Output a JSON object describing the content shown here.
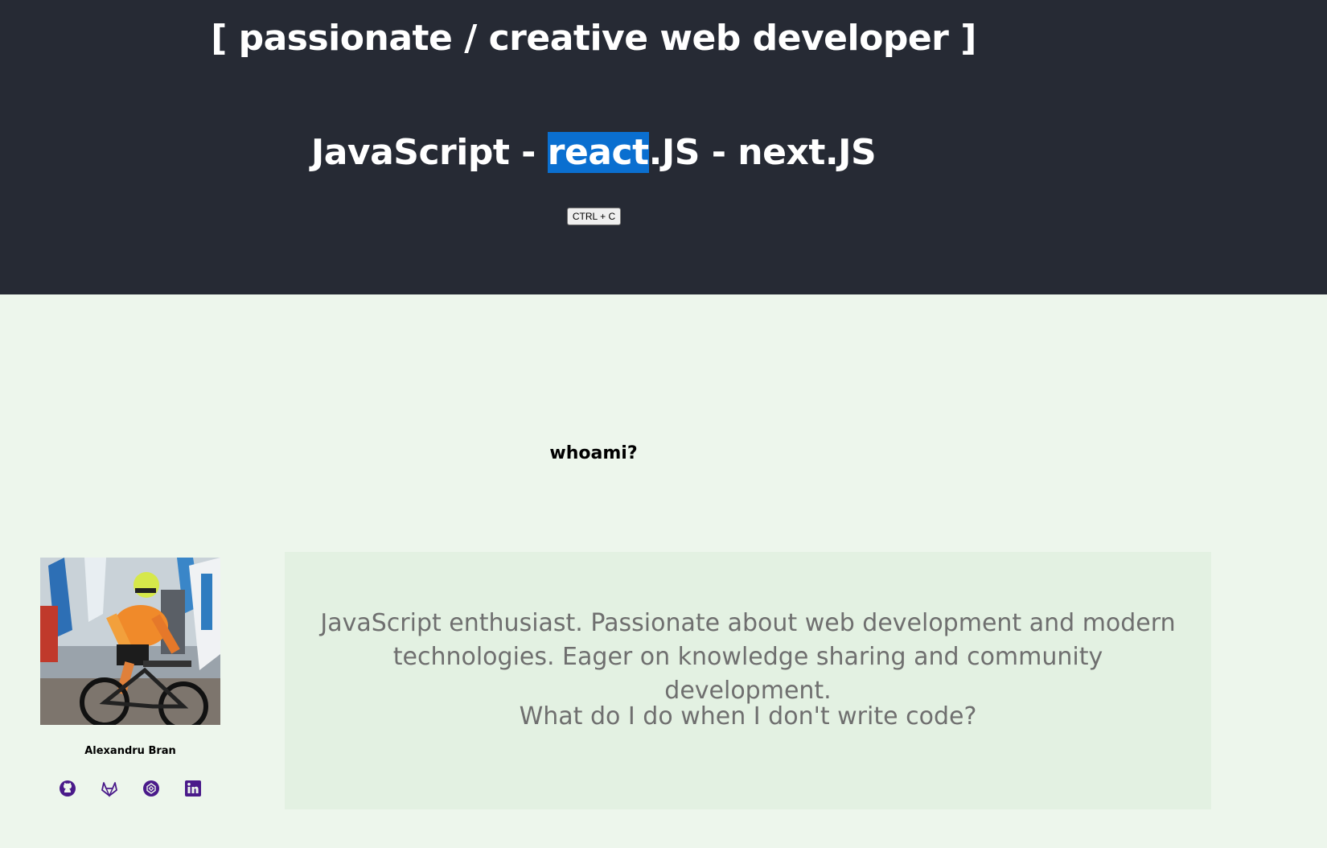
{
  "hero": {
    "title": "[ passionate / creative web developer ]",
    "tech": {
      "js": "JavaScript - ",
      "react_selected": "react",
      "react_rest": ".JS - next.JS"
    },
    "copy_button_label": "CTRL + C"
  },
  "about": {
    "section_title": "whoami?",
    "author_name": "Alexandru Bran",
    "bio": "JavaScript enthusiast. Passionate about web development and modern technologies. Eager on knowledge sharing and community development.",
    "question": "What do I do when I don't write code?"
  },
  "socials": [
    {
      "icon": "github-icon"
    },
    {
      "icon": "gitlab-icon"
    },
    {
      "icon": "codepen-icon"
    },
    {
      "icon": "linkedin-icon"
    }
  ],
  "colors": {
    "hero_bg": "#262a34",
    "page_bg": "#edf6ec",
    "bio_bg": "#e3f1e2",
    "selection": "#0a6fd0",
    "social_icon": "#4a1a8a"
  }
}
